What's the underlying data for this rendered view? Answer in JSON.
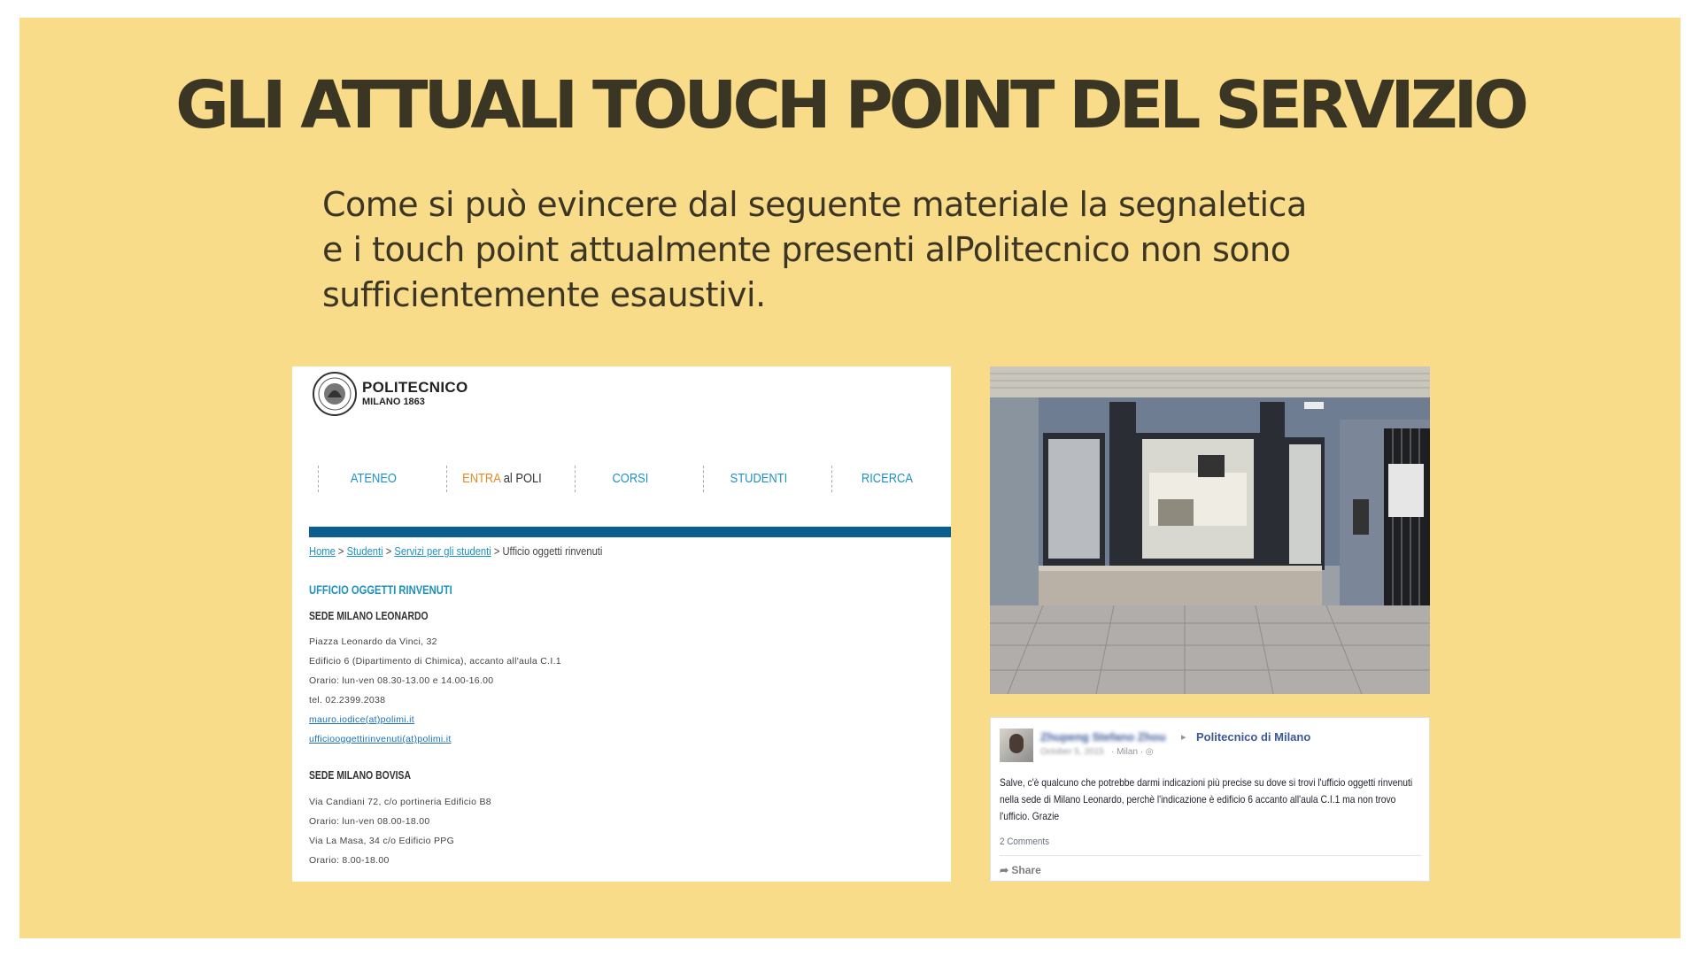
{
  "slide": {
    "title": "GLI ATTUALI TOUCH POINT DEL SERVIZIO",
    "intro_lines": [
      "Come si può evincere dal seguente materiale la segnaletica",
      "e i touch point attualmente presenti alPolitecnico non sono",
      "sufficientemente esaustivi."
    ],
    "background_color": "#f8dc8a",
    "title_color": "#3b3524"
  },
  "website": {
    "brand_name": "POLITECNICO",
    "brand_sub": "MILANO 1863",
    "nav": {
      "ateneo": "ATENEO",
      "entra_a": "ENTRA",
      "entra_b": " al POLI",
      "corsi": "CORSI",
      "studenti": "STUDENTI",
      "ricerca": "RICERCA"
    },
    "breadcrumb": {
      "home": "Home",
      "studenti": "Studenti",
      "servizi": "Servizi per gli studenti",
      "current": "Ufficio oggetti rinvenuti",
      "sep": " > "
    },
    "heading": "UFFICIO OGGETTI RINVENUTI",
    "sede_leonardo": {
      "title": "SEDE MILANO LEONARDO",
      "address": "Piazza Leonardo da Vinci, 32",
      "building": "Edificio 6 (Dipartimento di Chimica), accanto all'aula C.I.1",
      "hours": "Orario: lun-ven 08.30-13.00 e 14.00-16.00",
      "phone": "tel. 02.2399.2038",
      "email1": "mauro.iodice(at)polimi.it",
      "email2": "ufficiooggettirinvenuti(at)polimi.it"
    },
    "sede_bovisa": {
      "title": "SEDE MILANO BOVISA",
      "address1": "Via Candiani 72, c/o portineria Edificio B8",
      "hours1": "Orario: lun-ven 08.00-18.00",
      "address2": "Via La Masa, 34 c/o Edificio PPG",
      "hours2": "Orario: 8.00-18.00"
    },
    "accent_color": "#1b92bf",
    "bar_color": "#0c5e8f"
  },
  "facebook": {
    "author": "Zhupeng Stefano Zhou",
    "page": "Politecnico di Milano",
    "date": "October 5, 2015",
    "location": "· Milan · ◎",
    "text": "Salve, c'è qualcuno che potrebbe darmi indicazioni più precise su dove si trovi l'ufficio oggetti rinvenuti nella sede di Milano Leonardo, perchè l'indicazione è edificio 6 accanto all'aula C.I.1 ma non trovo l'ufficio. Grazie",
    "comments": "2 Comments",
    "share": "Share",
    "link_color": "#3b5998"
  }
}
